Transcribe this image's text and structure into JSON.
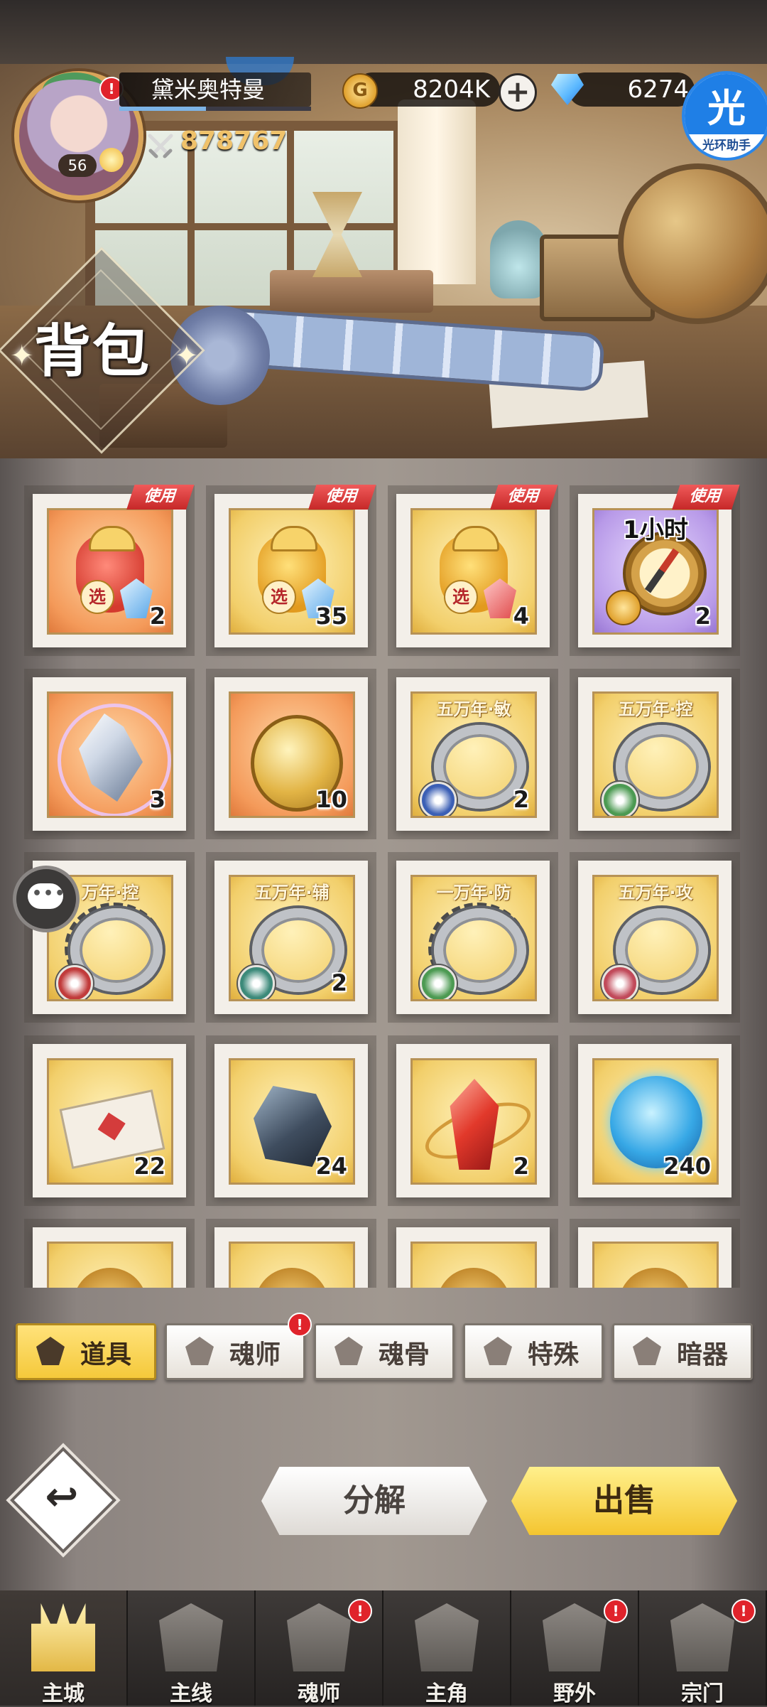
{
  "player": {
    "name": "黛米奥特曼",
    "level": "56",
    "power": "878767",
    "exp_progress": 0.45
  },
  "currency": {
    "gold": "8204K",
    "diamonds": "6274"
  },
  "helper": {
    "icon_char": "光",
    "label": "光环助手"
  },
  "page_title": "背包",
  "inventory": {
    "use_tag": "使用",
    "items": [
      {
        "count": "2",
        "art": "bag-red",
        "tag": "使用"
      },
      {
        "count": "35",
        "art": "bag-gold",
        "tag": "使用"
      },
      {
        "count": "4",
        "art": "bag-gold-red",
        "tag": "使用"
      },
      {
        "count": "2",
        "art": "compass",
        "tag": "使用",
        "label": "1小时"
      },
      {
        "count": "3",
        "art": "shard"
      },
      {
        "count": "10",
        "art": "medal"
      },
      {
        "count": "2",
        "art": "ring",
        "label": "五万年·敏"
      },
      {
        "count": "",
        "art": "ring",
        "label": "五万年·控"
      },
      {
        "count": "",
        "art": "ring-spiked",
        "label": "万年·控"
      },
      {
        "count": "2",
        "art": "ring",
        "label": "五万年·辅"
      },
      {
        "count": "",
        "art": "ring-spiked",
        "label": "一万年·防"
      },
      {
        "count": "",
        "art": "ring",
        "label": "五万年·攻"
      },
      {
        "count": "22",
        "art": "ticket"
      },
      {
        "count": "24",
        "art": "ore"
      },
      {
        "count": "2",
        "art": "red-crystal"
      },
      {
        "count": "240",
        "art": "blue-orb"
      },
      {
        "count": "",
        "art": "partial"
      },
      {
        "count": "",
        "art": "partial"
      },
      {
        "count": "",
        "art": "partial"
      },
      {
        "count": "",
        "art": "partial"
      }
    ]
  },
  "tabs": [
    {
      "label": "道具",
      "active": true
    },
    {
      "label": "魂师",
      "badge": "!"
    },
    {
      "label": "魂骨"
    },
    {
      "label": "特殊"
    },
    {
      "label": "暗器"
    }
  ],
  "actions": {
    "decompose": "分解",
    "sell": "出售"
  },
  "nav": [
    {
      "label": "主城",
      "active": true
    },
    {
      "label": "主线"
    },
    {
      "label": "魂师",
      "badge": "!"
    },
    {
      "label": "主角"
    },
    {
      "label": "野外",
      "badge": "!"
    },
    {
      "label": "宗门",
      "badge": "!"
    }
  ],
  "colors": {
    "accent_gold": "#f5c93b",
    "alert_red": "#e0232b",
    "power_text": "#f0c26a"
  }
}
